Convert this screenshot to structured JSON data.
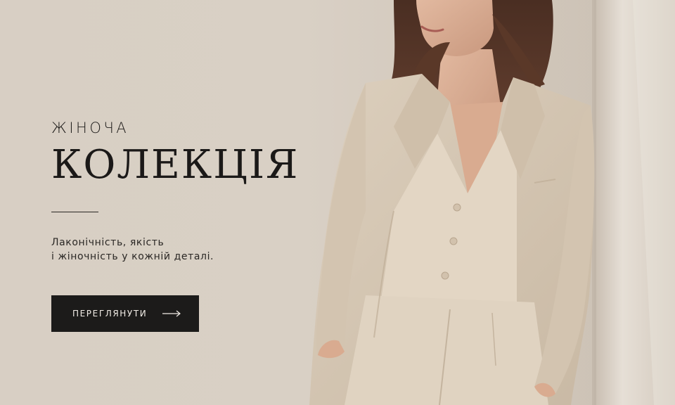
{
  "hero": {
    "eyebrow": "ЖІНОЧА",
    "headline": "КОЛЕКЦІЯ",
    "tagline_line1": "Лаконічність, якість",
    "tagline_line2": "і жіночність у кожній деталі.",
    "cta_label": "ПЕРЕГЛЯНУТИ",
    "cta_icon": "arrow-right-icon",
    "image_subject": "model-photo"
  },
  "colors": {
    "background": "#d8cfc4",
    "text": "#1b1918",
    "button_bg": "#1c1b1a",
    "button_text": "#f1ece6",
    "suit": "#d9cbb7"
  }
}
